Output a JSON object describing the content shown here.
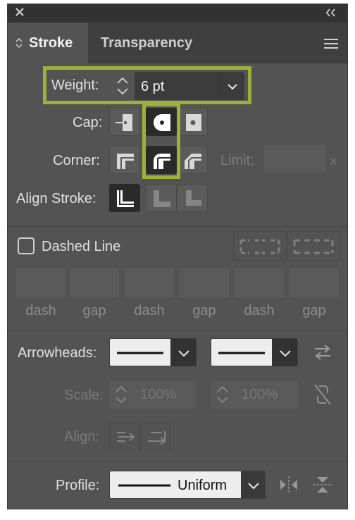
{
  "tabs": {
    "stroke": "Stroke",
    "transparency": "Transparency"
  },
  "weight": {
    "label": "Weight:",
    "value": "6 pt"
  },
  "cap": {
    "label": "Cap:"
  },
  "corner": {
    "label": "Corner:",
    "limit_label": "Limit:",
    "limit_suffix": "x"
  },
  "align_stroke": {
    "label": "Align Stroke:"
  },
  "dashed": {
    "label": "Dashed Line",
    "checked": false,
    "fields": [
      "dash",
      "gap",
      "dash",
      "gap",
      "dash",
      "gap"
    ]
  },
  "arrowheads": {
    "label": "Arrowheads:"
  },
  "scale": {
    "label": "Scale:",
    "start": "100%",
    "end": "100%"
  },
  "align": {
    "label": "Align:"
  },
  "profile": {
    "label": "Profile:",
    "value": "Uniform"
  },
  "colors": {
    "panel": "#535353",
    "highlight": "#9cb13a",
    "selected": "#2a2a2a"
  }
}
